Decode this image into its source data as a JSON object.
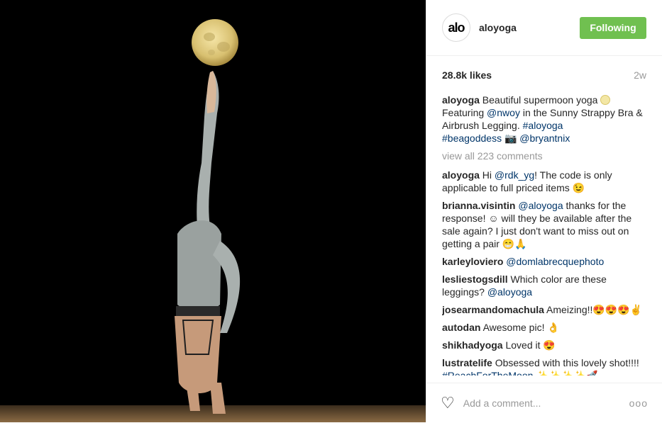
{
  "header": {
    "avatar_text": "alo",
    "username": "aloyoga",
    "follow_label": "Following"
  },
  "stats": {
    "likes": "28.8k likes",
    "time": "2w"
  },
  "caption": {
    "user": "aloyoga",
    "t1": " Beautiful supermoon yoga ",
    "t2": " Featuring ",
    "m1": "@nwoy",
    "t3": " in the Sunny Strappy Bra & Airbrush Legging. ",
    "h1": "#aloyoga",
    "h2": "#beagoddess",
    "t4": " 📷 ",
    "m2": "@bryantnix"
  },
  "view_all": "view all 223 comments",
  "comments": [
    {
      "user": "aloyoga",
      "pre": " Hi ",
      "mention": "@rdk_yg",
      "post": "! The code is only applicable to full priced items 😉"
    },
    {
      "user": "brianna.visintin",
      "pre": " ",
      "mention": "@aloyoga",
      "post": " thanks for the response! ☺ will they be available after the sale again? I just don't want to miss out on getting a pair 😁🙏"
    },
    {
      "user": "karleyloviero",
      "pre": " ",
      "mention": "@domlabrecquephoto",
      "post": ""
    },
    {
      "user": "lesliestogsdill",
      "pre": " Which color are these leggings? ",
      "mention": "@aloyoga",
      "post": ""
    },
    {
      "user": "josearmandomachula",
      "pre": " Ameizing!!😍😍😍✌",
      "mention": "",
      "post": ""
    },
    {
      "user": "autodan",
      "pre": " Awesome pic! 👌",
      "mention": "",
      "post": ""
    },
    {
      "user": "shikhadyoga",
      "pre": " Loved it 😍",
      "mention": "",
      "post": ""
    },
    {
      "user": "lustratelife",
      "pre": " Obsessed with this lovely shot!!!! ",
      "mention": "#ReachForTheMoon",
      "post": " ✨✨✨✨🚀"
    }
  ],
  "footer": {
    "placeholder": "Add a comment...",
    "more": "ooo"
  },
  "icons": {
    "like": "heart-icon",
    "more": "more-options-icon",
    "brand_color": "#70c050"
  }
}
